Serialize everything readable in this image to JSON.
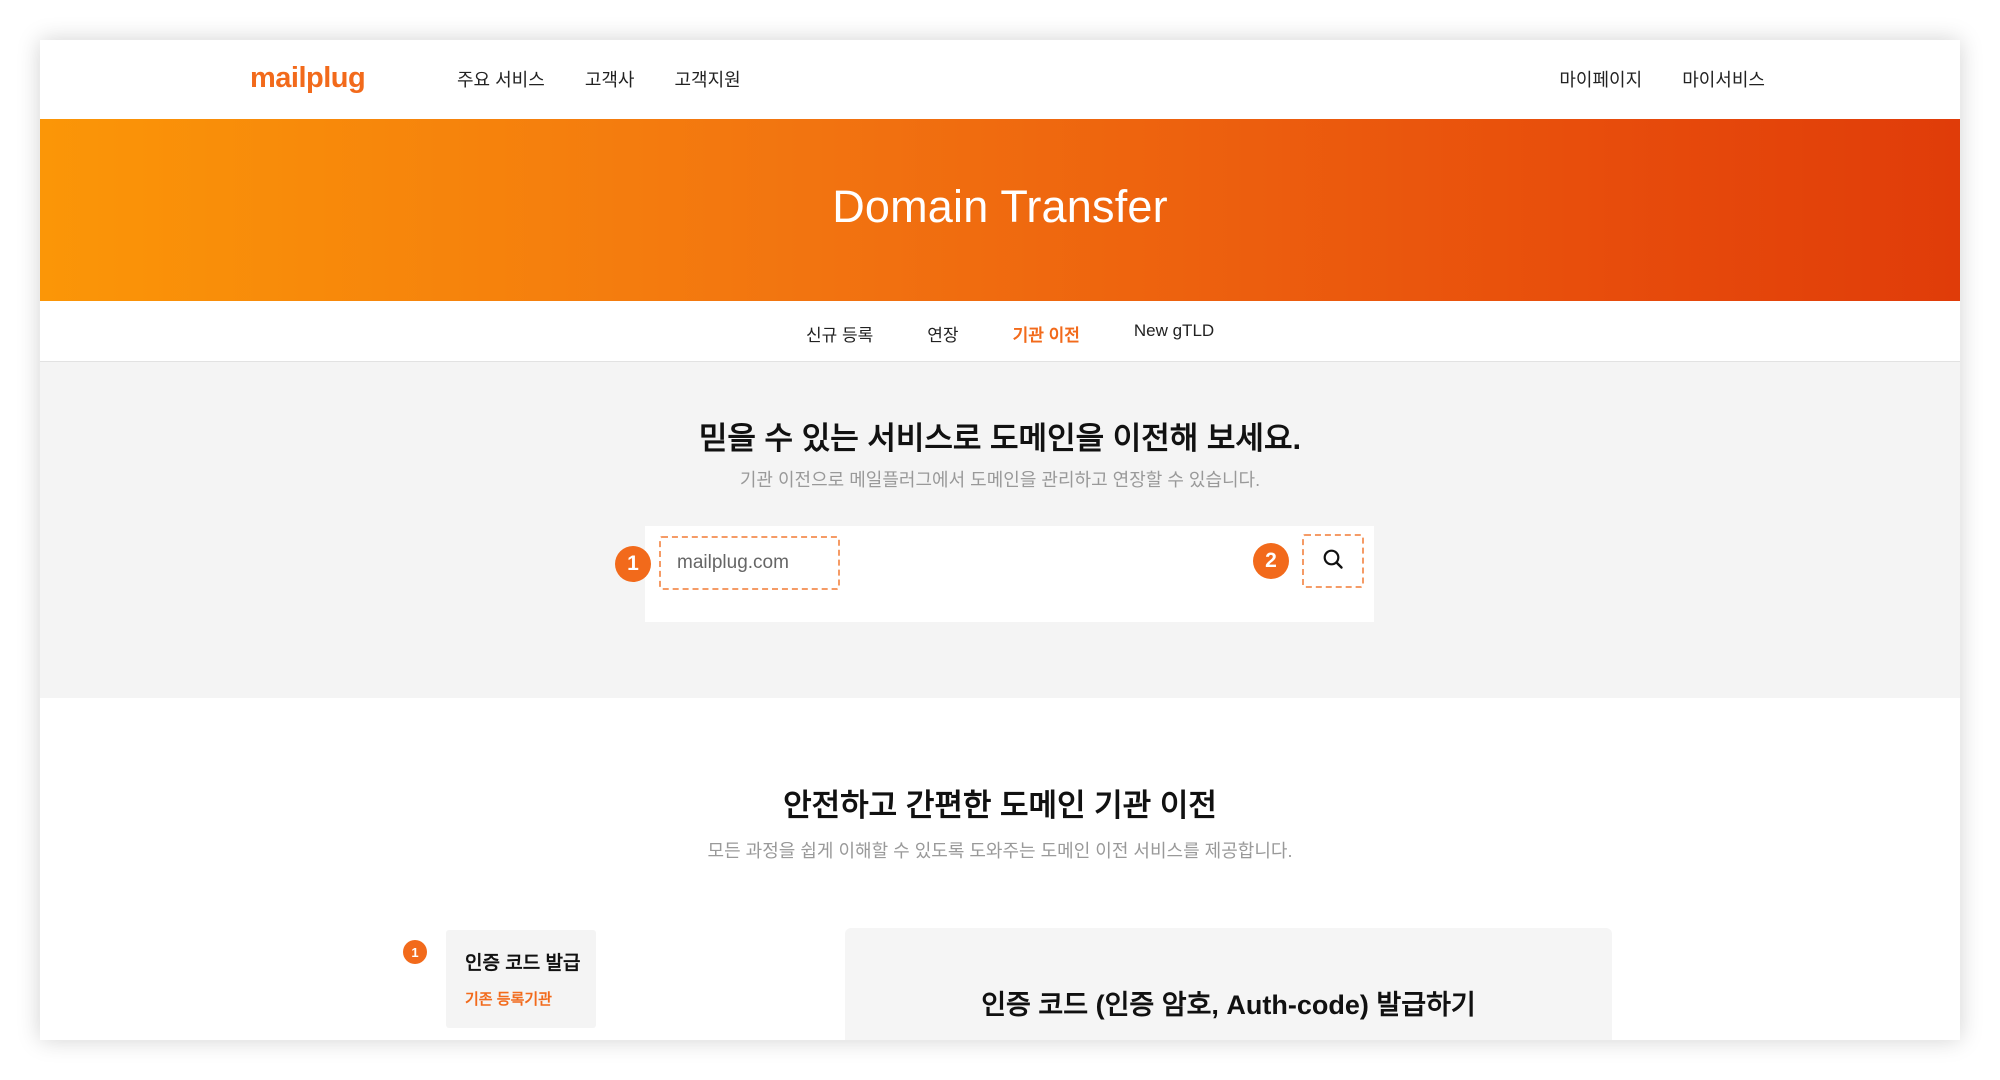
{
  "header": {
    "logo": "mailplug",
    "nav": [
      "주요 서비스",
      "고객사",
      "고객지원"
    ],
    "nav_right": [
      "마이페이지",
      "마이서비스"
    ]
  },
  "hero": {
    "title": "Domain Transfer"
  },
  "subtabs": {
    "items": [
      {
        "label": "신규 등록",
        "active": false
      },
      {
        "label": "연장",
        "active": false
      },
      {
        "label": "기관 이전",
        "active": true
      },
      {
        "label": "New gTLD",
        "active": false
      }
    ]
  },
  "search": {
    "title": "믿을 수 있는 서비스로 도메인을 이전해 보세요.",
    "subtitle": "기관 이전으로 메일플러그에서 도메인을 관리하고 연장할 수 있습니다.",
    "placeholder": "mailplug.com",
    "badge_input": "1",
    "badge_button": "2"
  },
  "info": {
    "title": "안전하고 간편한 도메인 기관 이전",
    "subtitle": "모든 과정을 쉽게 이해할 수 있도록 도와주는 도메인 이전 서비스를 제공합니다.",
    "step": {
      "number": "1",
      "title": "인증 코드 발급",
      "subtitle": "기존 등록기관"
    },
    "detail_title": "인증 코드 (인증 암호, Auth-code) 발급하기"
  },
  "colors": {
    "accent": "#f26a1b",
    "hero_start": "#fb9607",
    "hero_end": "#e03c09"
  },
  "icons": {
    "search": "search-icon"
  }
}
